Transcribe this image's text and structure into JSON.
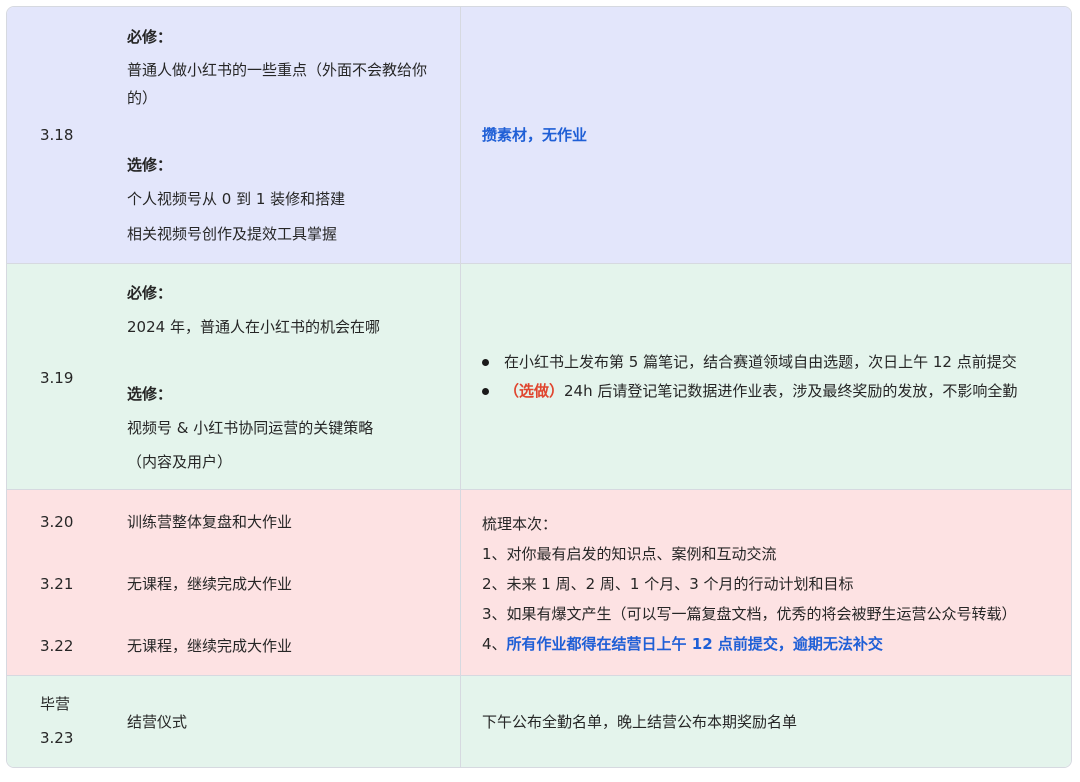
{
  "rows": [
    {
      "date": "3.18",
      "required_label": "必修：",
      "required_lines": [
        "普通人做小红书的一些重点（外面不会教给你",
        "的）"
      ],
      "elective_label": "选修：",
      "elective_lines": [
        "个人视频号从 0 到 1 装修和搭建",
        "相关视频号创作及提效工具掌握"
      ],
      "task": "攒素材，无作业"
    },
    {
      "date": "3.19",
      "required_label": "必修：",
      "required_lines": [
        "2024 年，普通人在小红书的机会在哪"
      ],
      "elective_label": "选修：",
      "elective_lines": [
        "视频号 & 小红书协同运营的关键策略",
        "（内容及用户）"
      ],
      "tasks": [
        {
          "text": "在小红书上发布第 5 篇笔记，结合赛道领域自由选题，次日上午 12 点前提交"
        },
        {
          "tag": "（选做）",
          "text": "24h 后请登记笔记数据进作业表，涉及最终奖励的发放，不影响全勤"
        }
      ]
    },
    {
      "days": [
        {
          "date": "3.20",
          "content": "训练营整体复盘和大作业"
        },
        {
          "date": "3.21",
          "content": "无课程，继续完成大作业"
        },
        {
          "date": "3.22",
          "content": "无课程，继续完成大作业"
        }
      ],
      "review_title": "梳理本次：",
      "review_items": [
        "1、对你最有启发的知识点、案例和互动交流",
        "2、未来 1 周、2 周、1 个月、3 个月的行动计划和目标",
        "3、如果有爆文产生（可以写一篇复盘文档，优秀的将会被野生运营公众号转载）"
      ],
      "final_prefix": "4、",
      "final_note": "所有作业都得在结营日上午 12 点前提交，逾期无法补交"
    },
    {
      "date_line1": "毕营",
      "date_line2": "3.23",
      "content": "结营仪式",
      "task": "下午公布全勤名单，晚上结营公布本期奖励名单"
    }
  ],
  "colors": {
    "row_blue": "#e3e6fb",
    "row_green": "#e4f4ec",
    "row_pink": "#fde2e3",
    "highlight_blue": "#1f5fd6",
    "highlight_red": "#e0452e"
  }
}
